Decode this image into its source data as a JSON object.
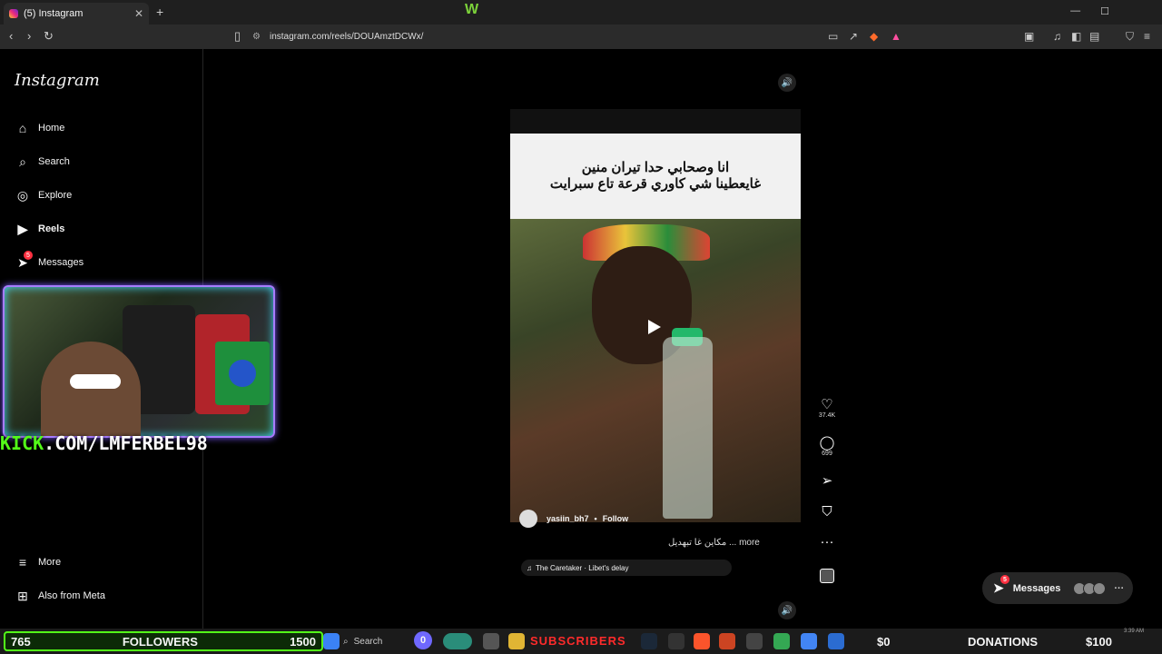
{
  "browser": {
    "tab_title": "(5) Instagram",
    "new_tab": "+",
    "url": "instagram.com/reels/DOUAmztDCWx/"
  },
  "sidebar": {
    "logo": "Instagram",
    "items": [
      {
        "label": "Home"
      },
      {
        "label": "Search"
      },
      {
        "label": "Explore"
      },
      {
        "label": "Reels"
      },
      {
        "label": "Messages",
        "badge": "5"
      }
    ],
    "more": "More",
    "meta": "Also from Meta"
  },
  "stream": {
    "kick_prefix": "KICK",
    "kick_rest": ".COM/LMFERBEL98"
  },
  "reel": {
    "caption_line1": "انا وصحابي حدا تيران منين",
    "caption_line2": "غايعطينا شي كاوري قرعة تاع سبرايت",
    "owner": "yasiin_bh7",
    "follow": "Follow",
    "description": "مكاين غا تبهديل ... more",
    "audio": "The Caretaker · Libet's delay",
    "likes": "37.4K",
    "comments": "699"
  },
  "messages_pill": {
    "label": "Messages",
    "badge": "5",
    "more": "···"
  },
  "taskbar": {
    "followers_count": "765",
    "followers_label": "FOLLOWERS",
    "followers_goal": "1500",
    "search": "Search",
    "zero": "0",
    "subscribers": "SUBSCRIBERS",
    "donation_amount": "$0",
    "donation_label": "DONATIONS",
    "donation_goal": "$100",
    "time": "3:39 AM"
  }
}
